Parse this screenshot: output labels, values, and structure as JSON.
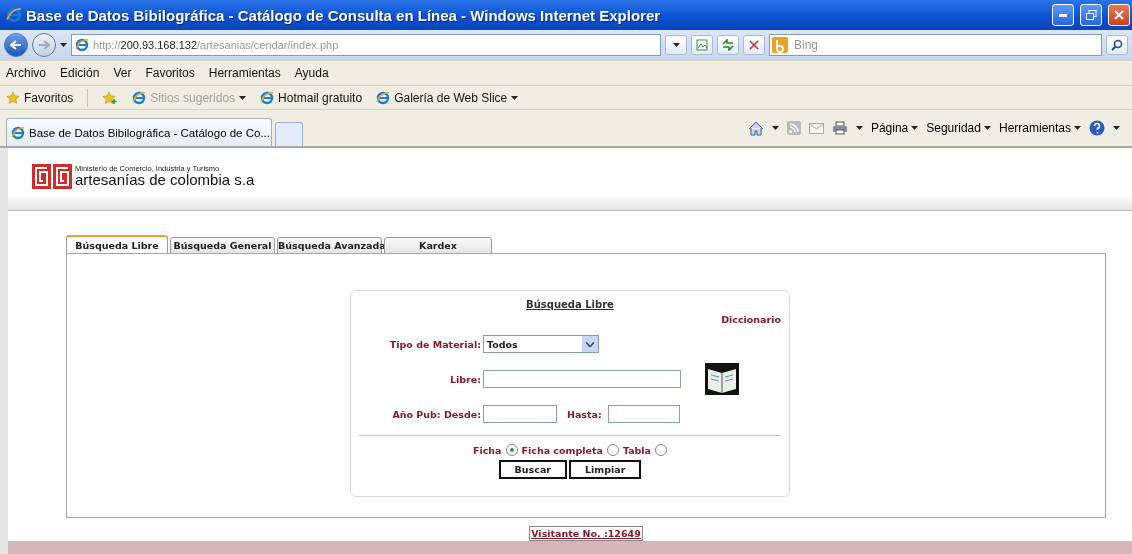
{
  "window": {
    "title": "Base de Datos Bibilográfica - Catálogo de Consulta en Línea - Windows Internet Explorer"
  },
  "address_bar": {
    "scheme": "http://",
    "host": "200.93.168.132",
    "path": "/artesanias/cendar/index.php"
  },
  "search": {
    "placeholder": "Bing"
  },
  "menu": [
    "Archivo",
    "Edición",
    "Ver",
    "Favoritos",
    "Herramientas",
    "Ayuda"
  ],
  "favorites_bar": [
    {
      "label": "Favoritos",
      "kind": "favorites",
      "disabled": false,
      "dropdown": false
    },
    {
      "label": "Sitios sugeridos",
      "kind": "link",
      "disabled": true,
      "dropdown": true
    },
    {
      "label": "Hotmail gratuito",
      "kind": "link",
      "disabled": false,
      "dropdown": false
    },
    {
      "label": "Galería de Web Slice",
      "kind": "link",
      "disabled": false,
      "dropdown": true
    }
  ],
  "browser_tab": {
    "label": "Base de Datos Bibilográfica - Catálogo de Co..."
  },
  "command_bar": [
    "Página",
    "Seguridad",
    "Herramientas"
  ],
  "site": {
    "ministry": "Ministerio de Comercio, Industria y Turismo",
    "brand": "artesanías de colombia s.a"
  },
  "tabs": [
    {
      "label": "Búsqueda Libre",
      "selected": true
    },
    {
      "label": "Búsqueda General",
      "selected": false
    },
    {
      "label": "Búsqueda Avanzada",
      "selected": false
    },
    {
      "label": "Kardex",
      "selected": false
    }
  ],
  "form": {
    "title": "Búsqueda Libre",
    "dictionary_link": "Diccionario",
    "material": {
      "label": "Tipo de Material:",
      "value": "Todos"
    },
    "libre": {
      "label": "Libre:"
    },
    "year": {
      "from_label": "Año Pub: Desde:",
      "to_label": "Hasta:"
    },
    "view_options": [
      {
        "label": "Ficha",
        "selected": true
      },
      {
        "label": "Ficha completa",
        "selected": false
      },
      {
        "label": "Tabla",
        "selected": false
      }
    ],
    "buttons": [
      "Buscar",
      "Limpiar"
    ]
  },
  "visitor": "Visitante No. :12649"
}
